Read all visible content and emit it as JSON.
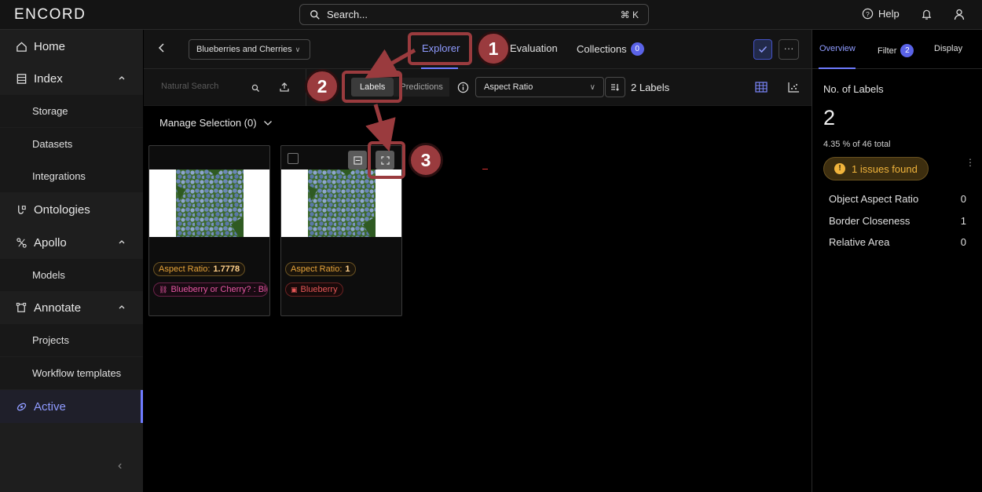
{
  "app": {
    "logo": "ENCORD"
  },
  "search": {
    "label": "Search...",
    "shortcut": "⌘ K"
  },
  "header_right": {
    "help": "Help"
  },
  "sidebar": {
    "home": "Home",
    "index": "Index",
    "index_children": [
      "Storage",
      "Datasets",
      "Integrations"
    ],
    "ontologies": "Ontologies",
    "apollo": "Apollo",
    "apollo_children": [
      "Models"
    ],
    "annotate": "Annotate",
    "annotate_children": [
      "Projects",
      "Workflow templates"
    ],
    "active": "Active"
  },
  "main_header": {
    "project": "Blueberries and Cherries",
    "tabs": {
      "explorer": "Explorer",
      "evaluation": "Evaluation",
      "collections": "Collections",
      "collections_count": "0"
    }
  },
  "toolbar": {
    "natural_search_placeholder": "Natural Search",
    "segment": {
      "labels": "Labels",
      "predictions": "Predictions"
    },
    "metric": "Aspect Ratio",
    "labels_count": "2 Labels"
  },
  "manage_selection": "Manage Selection (0)",
  "cards": [
    {
      "aspect_label": "Aspect Ratio:",
      "aspect_value": "1.7778",
      "class_label": "Blueberry or Cherry? : Blu"
    },
    {
      "aspect_label": "Aspect Ratio:",
      "aspect_value": "1",
      "class_label": "Blueberry"
    }
  ],
  "annotations": {
    "step1": "1",
    "step2": "2",
    "step3": "3"
  },
  "right_panel": {
    "tabs": {
      "overview": "Overview",
      "filter": "Filter",
      "filter_count": "2",
      "display": "Display"
    },
    "title": "No. of Labels",
    "count": "2",
    "percent": "4.35 % of 46 total",
    "issues": "1 issues found",
    "metrics": [
      {
        "name": "Object Aspect Ratio",
        "value": "0"
      },
      {
        "name": "Border Closeness",
        "value": "1"
      },
      {
        "name": "Relative Area",
        "value": "0"
      }
    ]
  },
  "colors": {
    "accent": "#6e7bff",
    "annotation": "#9a3b3e",
    "warning": "#f1b43c"
  }
}
